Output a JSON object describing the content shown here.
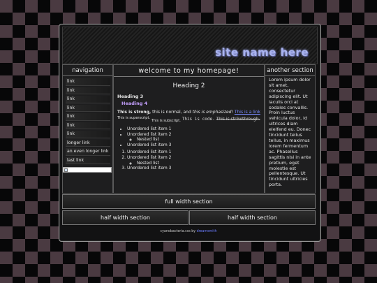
{
  "header": {
    "site_name": "site name here"
  },
  "navigation": {
    "title": "navigation",
    "items": [
      {
        "label": "link"
      },
      {
        "label": "link"
      },
      {
        "label": "link"
      },
      {
        "label": "link"
      },
      {
        "label": "link"
      },
      {
        "label": "link"
      },
      {
        "label": "link"
      },
      {
        "label": "longer link"
      },
      {
        "label": "an even longer link"
      },
      {
        "label": "last link"
      }
    ]
  },
  "main": {
    "title": "welcome to my homepage!",
    "heading2": "Heading 2",
    "heading3": "Heading 3",
    "heading4": "Heading 4",
    "strong": "This is strong,",
    "normal": " this is normal, and ",
    "emphasized": "this is emphasized!",
    "link": "This is a link",
    "superscript": "This is superscript.",
    "subscript": "This is subscript.",
    "code": "This is code.",
    "strikethrough": "This is strikethrough.",
    "ul": [
      "Unordered list item 1",
      "Unordered list item 2",
      "Nested list",
      "Unordered list item 3"
    ],
    "ol": [
      "Unordered list item 1",
      "Unordered list item 2",
      "Nested list",
      "Unordered list item 3"
    ]
  },
  "side": {
    "title": "another section",
    "text": "Lorem ipsum dolor sit amet, consectetur adipiscing elit. Ut iaculis orci at sodales convallis. Proin luctus vehicula dolor, id ultrices diam eleifend eu. Donec tincidunt tellus tellus, in maximus lorem fermentum ac. Phasellus sagittis nisi in ante pretium, eget molestie est pellentesque. Ut tincidunt ultricies porta."
  },
  "sections": {
    "full": "full width section",
    "half_left": "half width section",
    "half_right": "half width section"
  },
  "footer": {
    "prefix": "cyanobacteria.css by ",
    "author": "dreamsmith"
  },
  "colors": {
    "accent_link": "#7a8cff",
    "heading4": "#c5a0ff",
    "site_name": "#aab4ee"
  }
}
